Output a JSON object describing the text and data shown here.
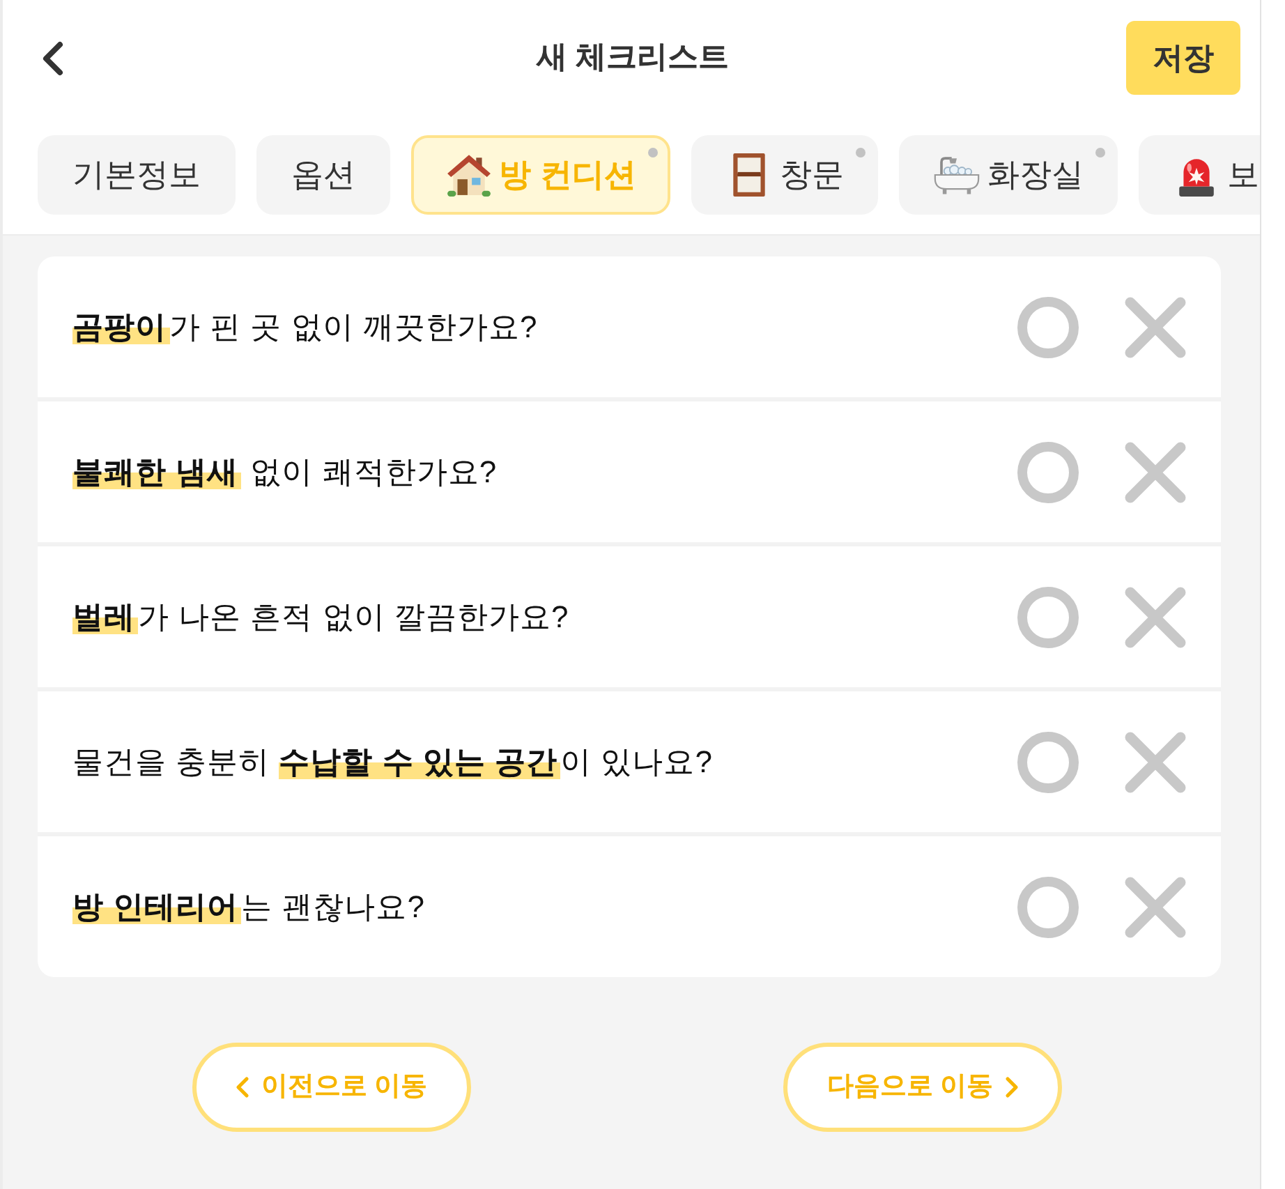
{
  "header": {
    "title": "새 체크리스트",
    "save_button": "저장"
  },
  "tabs": [
    {
      "label": "기본정보",
      "selected": false,
      "dot": false
    },
    {
      "label": "옵션",
      "selected": false,
      "dot": false
    },
    {
      "label": "방 컨디션",
      "selected": true,
      "dot": true
    },
    {
      "label": "창문",
      "selected": false,
      "dot": true
    },
    {
      "label": "화장실",
      "selected": false,
      "dot": true
    },
    {
      "label": "보",
      "selected": false,
      "dot": false
    }
  ],
  "questions": [
    {
      "text": "**곰팡이**가 핀 곳 없이 깨끗한가요?",
      "answers": [
        {
          "kind": "o",
          "selected": false
        },
        {
          "kind": "x",
          "selected": false
        }
      ]
    },
    {
      "text": "**불쾌한 냄새** 없이 쾌적한가요?",
      "answers": [
        {
          "kind": "o",
          "selected": false
        },
        {
          "kind": "x",
          "selected": false
        }
      ]
    },
    {
      "text": "**벌레**가 나온 흔적 없이 깔끔한가요?",
      "answers": [
        {
          "kind": "o",
          "selected": false
        },
        {
          "kind": "x",
          "selected": false
        }
      ]
    },
    {
      "text": "물건을 충분히 **수납할 수 있는 공간**이 있나요?",
      "answers": [
        {
          "kind": "o",
          "selected": false
        },
        {
          "kind": "x",
          "selected": false
        }
      ]
    },
    {
      "text": "**방 인테리어**는 괜찮나요?",
      "answers": [
        {
          "kind": "o",
          "selected": false
        },
        {
          "kind": "x",
          "selected": false
        }
      ]
    }
  ],
  "navigation": {
    "previous": "이전으로 이동",
    "next": "다음으로 이동"
  }
}
